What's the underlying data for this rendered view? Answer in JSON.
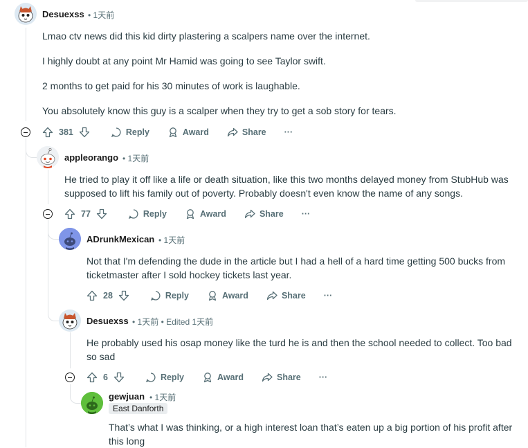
{
  "labels": {
    "reply": "Reply",
    "award": "Award",
    "share": "Share",
    "more": "···"
  },
  "comments": [
    {
      "user": "Desuexss",
      "time": "1天前",
      "paragraphs": [
        "Lmao ctv news did this kid dirty plastering a scalpers name over the internet.",
        "I highly doubt at any point Mr Hamid was going to see Taylor swift.",
        "2 months to get paid for his 30 minutes of work is laughable.",
        "You absolutely know this guy is a scalper when they try to get a sob story for tears."
      ],
      "votes": "381"
    },
    {
      "user": "appleorango",
      "time": "1天前",
      "paragraphs": [
        "He tried to play it off like a life or death situation, like this two months delayed money from StubHub was supposed to lift his family out of poverty. Probably doesn't even know the name of any songs."
      ],
      "votes": "77"
    },
    {
      "user": "ADrunkMexican",
      "time": "1天前",
      "paragraphs": [
        "Not that I'm defending the dude in the article but I had a hell of a hard time getting 500 bucks from ticketmaster after I sold hockey tickets last year."
      ],
      "votes": "28"
    },
    {
      "user": "Desuexss",
      "time": "1天前",
      "edited": "Edited 1天前",
      "paragraphs": [
        "He probably used his osap money like the turd he is and then the school needed to collect. Too bad so sad"
      ],
      "votes": "6"
    },
    {
      "user": "gewjuan",
      "time": "1天前",
      "flair": "East Danforth",
      "paragraphs": [
        "That’s what I was thinking, or a high interest loan that’s eaten up a big portion of his profit after this long"
      ]
    }
  ]
}
